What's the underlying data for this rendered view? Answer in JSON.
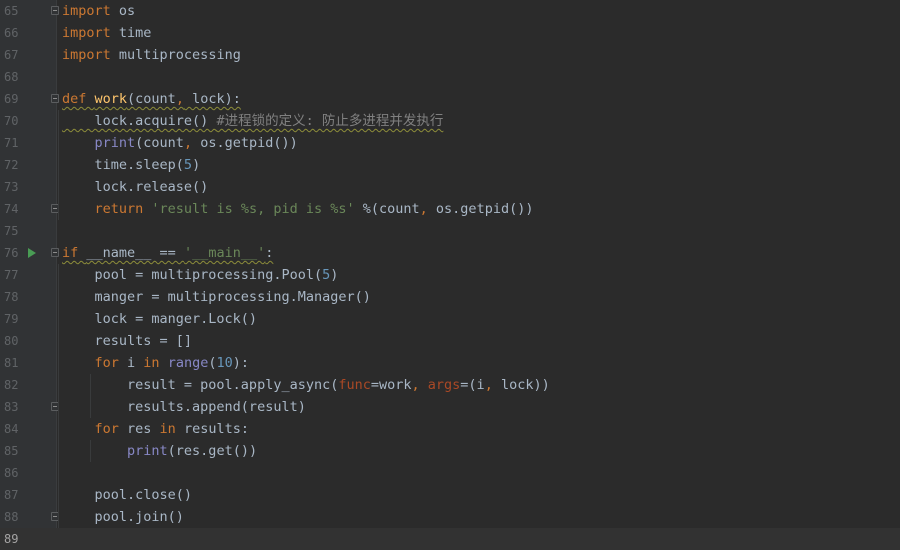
{
  "editor": {
    "lines": [
      {
        "n": "65",
        "tokens": [
          [
            "kw",
            "import"
          ],
          [
            "pl",
            " os"
          ]
        ]
      },
      {
        "n": "66",
        "tokens": [
          [
            "kw",
            "import"
          ],
          [
            "pl",
            " time"
          ]
        ]
      },
      {
        "n": "67",
        "tokens": [
          [
            "kw",
            "import"
          ],
          [
            "pl",
            " multiprocessing"
          ]
        ]
      },
      {
        "n": "68",
        "tokens": []
      },
      {
        "n": "69",
        "tokens": [
          [
            "kw",
            "def "
          ],
          [
            "fn",
            "work"
          ],
          [
            "pl",
            "(count"
          ],
          [
            "kw",
            ","
          ],
          [
            "pl",
            " lock):"
          ]
        ]
      },
      {
        "n": "70",
        "tokens": [
          [
            "pl",
            "    lock.acquire() "
          ],
          [
            "cmt",
            "#进程锁的定义: 防止多进程并发执行"
          ]
        ]
      },
      {
        "n": "71",
        "tokens": [
          [
            "pl",
            "    "
          ],
          [
            "bi",
            "print"
          ],
          [
            "pl",
            "(count"
          ],
          [
            "kw",
            ","
          ],
          [
            "pl",
            " os.getpid())"
          ]
        ]
      },
      {
        "n": "72",
        "tokens": [
          [
            "pl",
            "    time.sleep("
          ],
          [
            "num",
            "5"
          ],
          [
            "pl",
            ")"
          ]
        ]
      },
      {
        "n": "73",
        "tokens": [
          [
            "pl",
            "    lock.release()"
          ]
        ]
      },
      {
        "n": "74",
        "tokens": [
          [
            "pl",
            "    "
          ],
          [
            "kw",
            "return "
          ],
          [
            "str",
            "'result is %s, pid is %s' "
          ],
          [
            "pl",
            "%(count"
          ],
          [
            "kw",
            ","
          ],
          [
            "pl",
            " os.getpid())"
          ]
        ]
      },
      {
        "n": "75",
        "tokens": []
      },
      {
        "n": "76",
        "tokens": [
          [
            "kw",
            "if "
          ],
          [
            "pl",
            "__name__ == "
          ],
          [
            "str",
            "'__main__'"
          ],
          [
            "pl",
            ":"
          ]
        ]
      },
      {
        "n": "77",
        "tokens": [
          [
            "pl",
            "    pool = multiprocessing.Pool("
          ],
          [
            "num",
            "5"
          ],
          [
            "pl",
            ")"
          ]
        ]
      },
      {
        "n": "78",
        "tokens": [
          [
            "pl",
            "    manger = multiprocessing.Manager()"
          ]
        ]
      },
      {
        "n": "79",
        "tokens": [
          [
            "pl",
            "    lock = manger.Lock()"
          ]
        ]
      },
      {
        "n": "80",
        "tokens": [
          [
            "pl",
            "    results = []"
          ]
        ]
      },
      {
        "n": "81",
        "tokens": [
          [
            "pl",
            "    "
          ],
          [
            "kw",
            "for "
          ],
          [
            "pl",
            "i "
          ],
          [
            "kw",
            "in "
          ],
          [
            "bi",
            "range"
          ],
          [
            "pl",
            "("
          ],
          [
            "num",
            "10"
          ],
          [
            "pl",
            "):"
          ]
        ]
      },
      {
        "n": "82",
        "tokens": [
          [
            "pl",
            "        result = pool.apply_async("
          ],
          [
            "kwarg",
            "func"
          ],
          [
            "pl",
            "=work"
          ],
          [
            "kw",
            ","
          ],
          [
            "pl",
            " "
          ],
          [
            "kwarg",
            "args"
          ],
          [
            "pl",
            "=(i"
          ],
          [
            "kw",
            ","
          ],
          [
            "pl",
            " lock))"
          ]
        ]
      },
      {
        "n": "83",
        "tokens": [
          [
            "pl",
            "        results.append(result)"
          ]
        ]
      },
      {
        "n": "84",
        "tokens": [
          [
            "pl",
            "    "
          ],
          [
            "kw",
            "for "
          ],
          [
            "pl",
            "res "
          ],
          [
            "kw",
            "in "
          ],
          [
            "pl",
            "results:"
          ]
        ]
      },
      {
        "n": "85",
        "tokens": [
          [
            "pl",
            "        "
          ],
          [
            "bi",
            "print"
          ],
          [
            "pl",
            "(res.get())"
          ]
        ]
      },
      {
        "n": "86",
        "tokens": []
      },
      {
        "n": "87",
        "tokens": [
          [
            "pl",
            "    pool.close()"
          ]
        ]
      },
      {
        "n": "88",
        "tokens": [
          [
            "pl",
            "    pool.join()"
          ]
        ]
      },
      {
        "n": "89",
        "tokens": []
      }
    ],
    "current_line": "89",
    "colors": {
      "background": "#2b2b2b",
      "gutter": "#313335",
      "keyword": "#cc7832",
      "function": "#ffc66d",
      "builtin": "#8888c6",
      "number": "#6897bb",
      "string": "#6a8759",
      "comment": "#808080",
      "kwarg": "#aa4926",
      "plain": "#a9b7c6",
      "line_number": "#606366",
      "run_marker": "#499c54"
    }
  }
}
